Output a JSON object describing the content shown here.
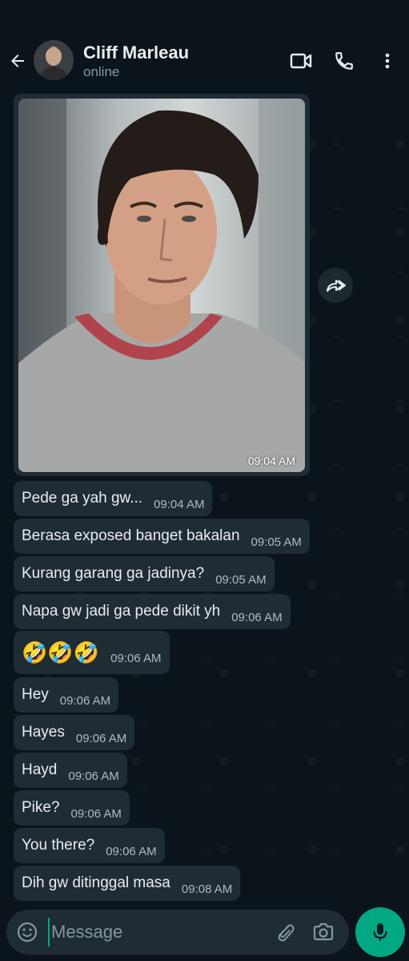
{
  "contact": {
    "name": "Cliff Marleau",
    "status": "online"
  },
  "header_icons": {
    "back": "arrow-back-icon",
    "video": "video-call-icon",
    "call": "phone-icon",
    "menu": "more-vertical-icon"
  },
  "image_message": {
    "time": "09:04 AM",
    "forward_icon": "forward-icon"
  },
  "messages": [
    {
      "text": "Pede ga yah gw...",
      "time": "09:04 AM"
    },
    {
      "text": "Berasa exposed banget bakalan",
      "time": "09:05 AM"
    },
    {
      "text": "Kurang garang ga jadinya?",
      "time": "09:05 AM"
    },
    {
      "text": "Napa gw jadi ga pede dikit yh",
      "time": "09:06 AM"
    },
    {
      "text": "🤣🤣🤣",
      "time": "09:06 AM"
    },
    {
      "text": "Hey",
      "time": "09:06 AM"
    },
    {
      "text": "Hayes",
      "time": "09:06 AM"
    },
    {
      "text": "Hayd",
      "time": "09:06 AM"
    },
    {
      "text": "Pike?",
      "time": "09:06 AM"
    },
    {
      "text": "You there?",
      "time": "09:06 AM"
    },
    {
      "text": "Dih gw ditinggal masa",
      "time": "09:08 AM"
    }
  ],
  "input": {
    "placeholder": "Message",
    "value": ""
  },
  "colors": {
    "background": "#0b141a",
    "bubble_incoming": "#1f2c34",
    "accent": "#00a884",
    "secondary_text": "#8696a0"
  }
}
